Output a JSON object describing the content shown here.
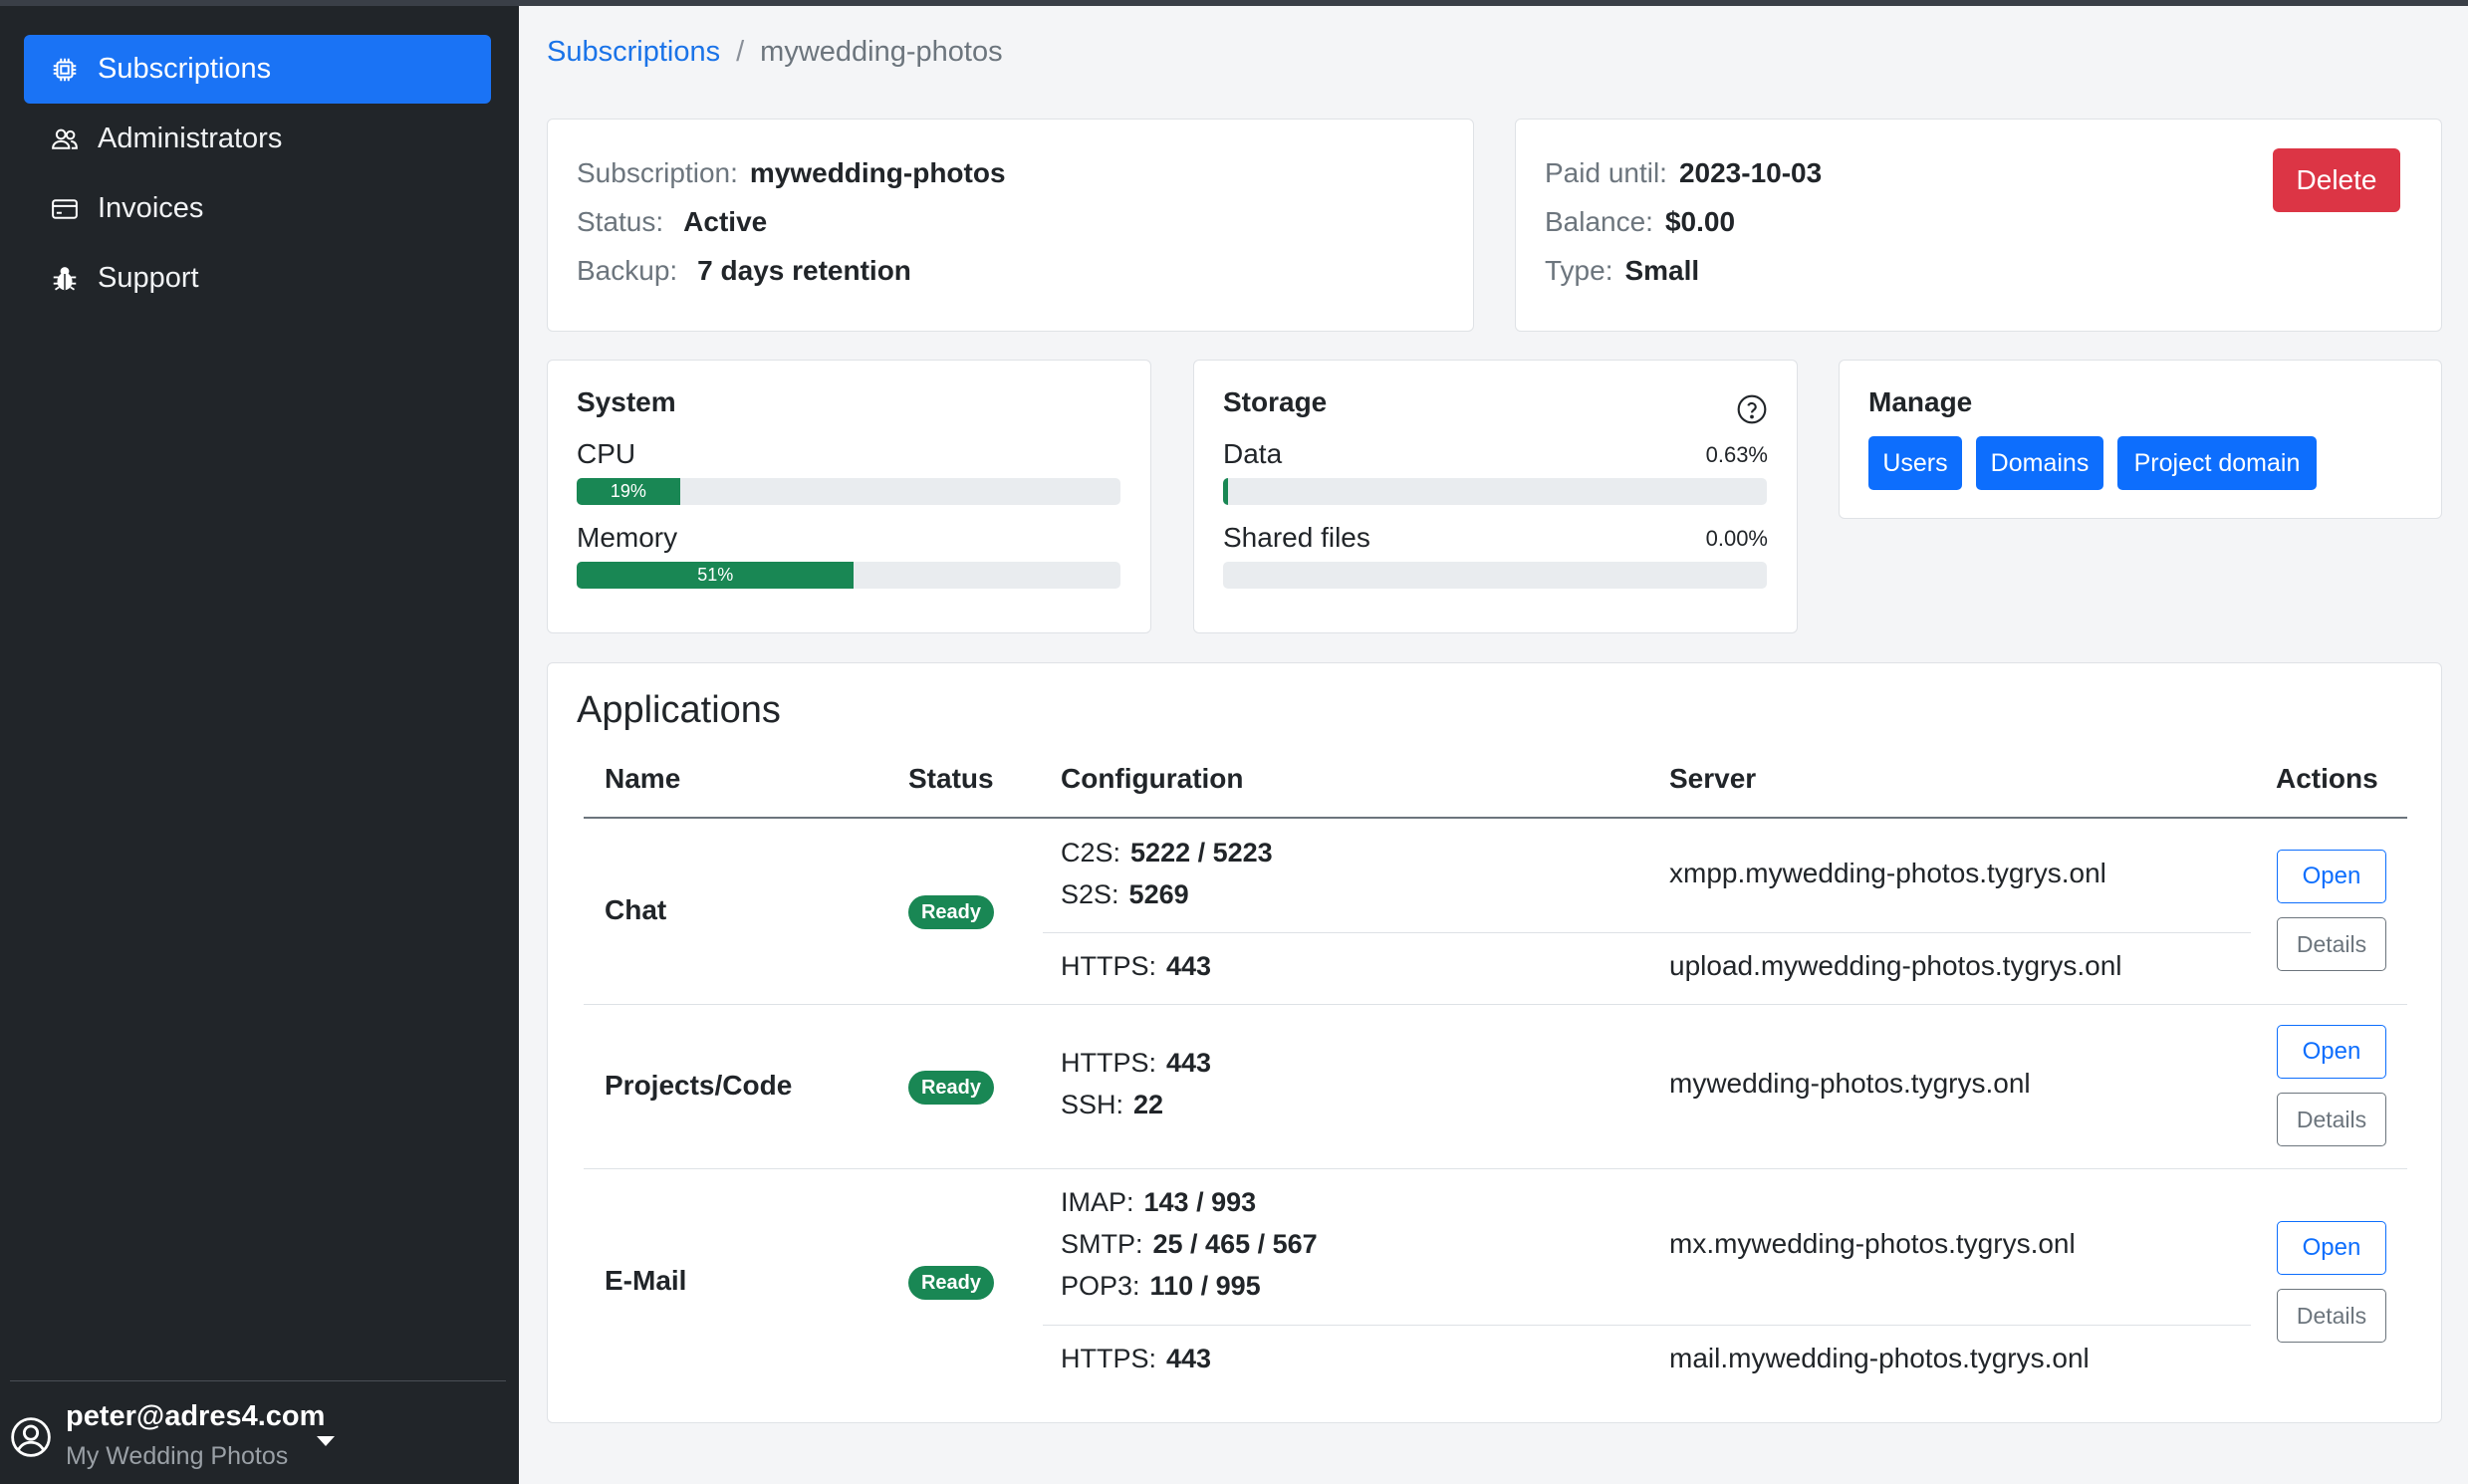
{
  "sidebar": {
    "items": [
      {
        "label": "Subscriptions",
        "icon": "chip-icon",
        "active": true
      },
      {
        "label": "Administrators",
        "icon": "users-icon",
        "active": false
      },
      {
        "label": "Invoices",
        "icon": "credit-card-icon",
        "active": false
      },
      {
        "label": "Support",
        "icon": "bug-icon",
        "active": false
      }
    ],
    "user": {
      "email": "peter@adres4.com",
      "org": "My Wedding Photos"
    }
  },
  "breadcrumb": {
    "root": "Subscriptions",
    "separator": "/",
    "current": "mywedding-photos"
  },
  "summary": {
    "subscription_label": "Subscription:",
    "subscription_value": "mywedding-photos",
    "status_label": "Status:",
    "status_value": "Active",
    "backup_label": "Backup:",
    "backup_value": "7 days retention"
  },
  "billing": {
    "paid_until_label": "Paid until:",
    "paid_until_value": "2023-10-03",
    "balance_label": "Balance:",
    "balance_value": "$0.00",
    "type_label": "Type:",
    "type_value": "Small",
    "delete_label": "Delete"
  },
  "system": {
    "title": "System",
    "cpu_label": "CPU",
    "cpu_percent": 19,
    "cpu_text": "19%",
    "memory_label": "Memory",
    "memory_percent": 51,
    "memory_text": "51%"
  },
  "storage": {
    "title": "Storage",
    "data_label": "Data",
    "data_value": "0.63%",
    "data_percent": 0.63,
    "shared_label": "Shared files",
    "shared_value": "0.00%",
    "shared_percent": 0
  },
  "manage": {
    "title": "Manage",
    "buttons": [
      "Users",
      "Domains",
      "Project domain"
    ]
  },
  "applications": {
    "title": "Applications",
    "columns": [
      "Name",
      "Status",
      "Configuration",
      "Server",
      "Actions"
    ],
    "open_label": "Open",
    "details_label": "Details",
    "rows": [
      {
        "name": "Chat",
        "status": "Ready",
        "groups": [
          {
            "config": [
              {
                "k": "C2S:",
                "v": "5222 / 5223"
              },
              {
                "k": "S2S:",
                "v": "5269"
              }
            ],
            "server": "xmpp.mywedding-photos.tygrys.onl"
          },
          {
            "config": [
              {
                "k": "HTTPS:",
                "v": "443"
              }
            ],
            "server": "upload.mywedding-photos.tygrys.onl"
          }
        ]
      },
      {
        "name": "Projects/Code",
        "status": "Ready",
        "groups": [
          {
            "config": [
              {
                "k": "HTTPS:",
                "v": "443"
              },
              {
                "k": "SSH:",
                "v": "22"
              }
            ],
            "server": "mywedding-photos.tygrys.onl"
          }
        ]
      },
      {
        "name": "E-Mail",
        "status": "Ready",
        "groups": [
          {
            "config": [
              {
                "k": "IMAP:",
                "v": "143 / 993"
              },
              {
                "k": "SMTP:",
                "v": "25 / 465 / 567"
              },
              {
                "k": "POP3:",
                "v": "110 / 995"
              }
            ],
            "server": "mx.mywedding-photos.tygrys.onl"
          },
          {
            "config": [
              {
                "k": "HTTPS:",
                "v": "443"
              }
            ],
            "server": "mail.mywedding-photos.tygrys.onl"
          }
        ]
      }
    ]
  }
}
